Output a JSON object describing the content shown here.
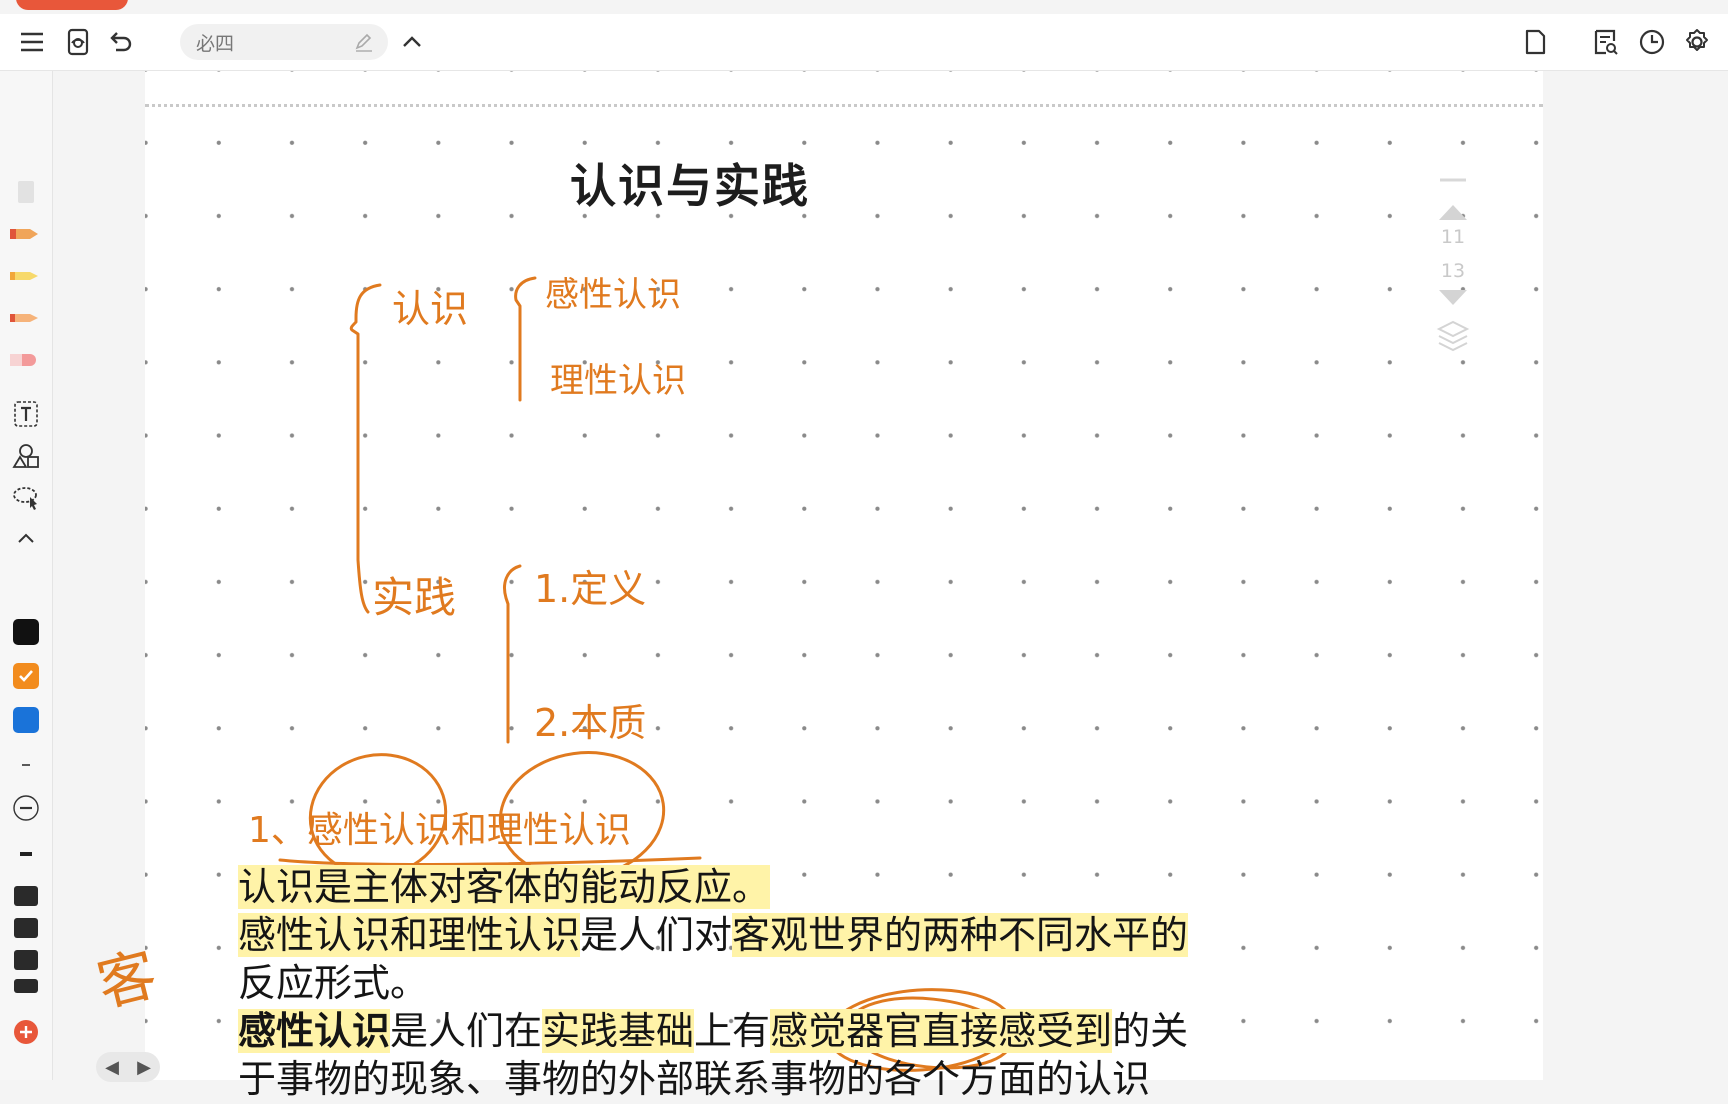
{
  "toolbar": {
    "notebook_title": "必四"
  },
  "page": {
    "title": "认识与实践",
    "pager": {
      "current": "11",
      "total": "13"
    }
  },
  "handwriting": {
    "branch_knowing": "认识",
    "sub_perceptual": "感性认识",
    "sub_rational": "理性认识",
    "branch_practice": "实践",
    "sub_definition": "1.定义",
    "sub_nature": "2.本质",
    "note_heading": "1、感性认识和理性认识",
    "margin_note": "客"
  },
  "body_text": {
    "line1": "认识是主体对客体的能动反应。",
    "line2_a": "感性认识和理性认识",
    "line2_b": "是人们对",
    "line2_c": "客观世界的两种不同水平的",
    "line3": "反应形式。",
    "line4_a": "感性认识",
    "line4_b": "是人们在",
    "line4_c": "实践基础",
    "line4_d": "上有",
    "line4_e": "感觉器官直接感受到",
    "line4_f": "的关",
    "line5": "于事物的现象、事物的外部联系事物的各个方面的认识"
  },
  "colors": {
    "ink_orange": "#e07a1f",
    "highlight_yellow": "#fff3a8",
    "swatch_black": "#111111",
    "swatch_orange": "#f28c1e",
    "swatch_blue": "#1a73d9",
    "accent_red": "#e8573a"
  },
  "icons": [
    "menu-icon",
    "read-mode-icon",
    "undo-icon",
    "edit-pencil-icon",
    "collapse-icon",
    "page-icon",
    "search-notes-icon",
    "history-icon",
    "settings-icon"
  ]
}
